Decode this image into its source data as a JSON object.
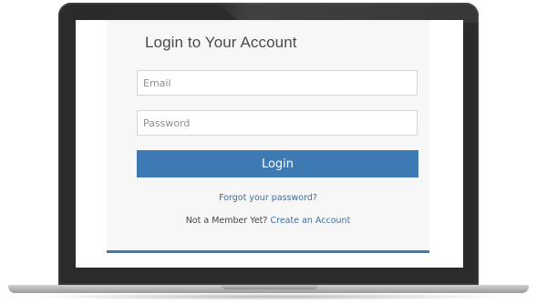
{
  "login": {
    "title": "Login to Your Account",
    "email_placeholder": "Email",
    "password_placeholder": "Password",
    "login_label": "Login",
    "forgot_label": "Forgot your password?",
    "not_member_label": "Not a Member Yet?",
    "create_account_label": "Create an Account"
  },
  "colors": {
    "accent": "#3d7ab3",
    "link": "#3d6f9f",
    "panel_bg": "#f7f7f7",
    "laptop_body": "#2b2b2b"
  }
}
